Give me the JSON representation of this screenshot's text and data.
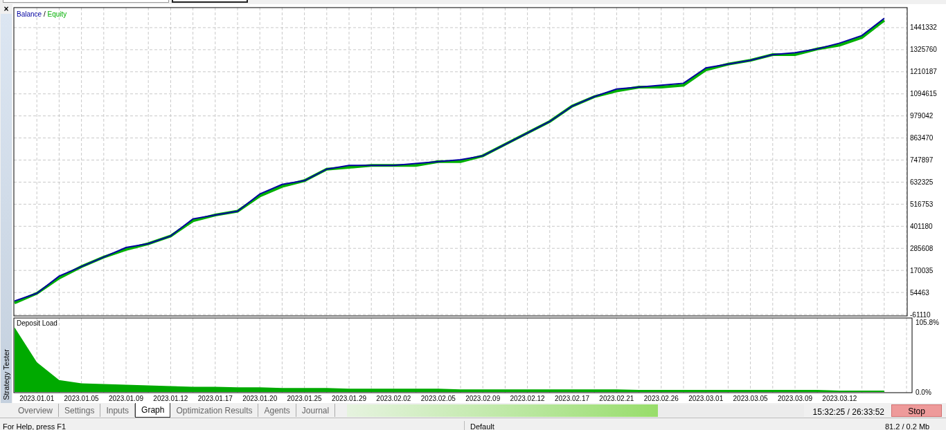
{
  "side_panel": {
    "close": "×",
    "title": "Strategy Tester"
  },
  "main_chart": {
    "separator": "/",
    "chart_data": {
      "type": "line",
      "grid": true,
      "categories": [
        null,
        null,
        null,
        null,
        null,
        null,
        null,
        null,
        null,
        null,
        null,
        null,
        null,
        null,
        null,
        null,
        null,
        null,
        null,
        null,
        null,
        null,
        null,
        null,
        null,
        null,
        null,
        null,
        null,
        null,
        null,
        null,
        null,
        null,
        null,
        null,
        null,
        null,
        null,
        null
      ],
      "ylim": [
        -68350,
        1546170
      ],
      "yticks": [
        -61110,
        54463,
        170035,
        285608,
        401180,
        516753,
        632325,
        747897,
        863470,
        979042,
        1094615,
        1210187,
        1325760,
        1441332
      ],
      "series": [
        {
          "name": "Equity",
          "color": "#00b000",
          "values": [
            0,
            50000,
            130000,
            190000,
            240000,
            280000,
            310000,
            350000,
            430000,
            460000,
            480000,
            560000,
            610000,
            640000,
            700000,
            710000,
            720000,
            720000,
            720000,
            740000,
            740000,
            770000,
            830000,
            890000,
            950000,
            1030000,
            1080000,
            1110000,
            1130000,
            1130000,
            1140000,
            1220000,
            1250000,
            1270000,
            1300000,
            1300000,
            1330000,
            1350000,
            1390000,
            1480000
          ]
        },
        {
          "name": "Balance",
          "color": "#0000a0",
          "values": [
            10000,
            50000,
            140000,
            190000,
            240000,
            290000,
            310000,
            350000,
            440000,
            460000,
            480000,
            570000,
            620000,
            640000,
            700000,
            720000,
            720000,
            720000,
            730000,
            740000,
            750000,
            770000,
            830000,
            890000,
            950000,
            1030000,
            1080000,
            1120000,
            1130000,
            1140000,
            1150000,
            1230000,
            1250000,
            1270000,
            1300000,
            1310000,
            1330000,
            1360000,
            1400000,
            1490000
          ]
        }
      ]
    }
  },
  "deposit_chart": {
    "chart_data": {
      "type": "area",
      "grid": true,
      "categories": [
        null,
        "2023.01.01",
        null,
        "2023.01.05",
        null,
        "2023.01.09",
        null,
        "2023.01.12",
        null,
        "2023.01.17",
        null,
        "2023.01.20",
        null,
        "2023.01.25",
        null,
        "2023.01.29",
        null,
        "2023.02.02",
        null,
        "2023.02.05",
        null,
        "2023.02.09",
        null,
        "2023.02.12",
        null,
        "2023.02.17",
        null,
        "2023.02.21",
        null,
        "2023.02.26",
        null,
        "2023.03.01",
        null,
        "2023.03.05",
        null,
        "2023.03.09",
        null,
        "2023.03.12",
        null,
        null
      ],
      "ylim": [
        0,
        112.1
      ],
      "yticks": [
        {
          "value": 0,
          "label": "0.0%"
        },
        {
          "value": 105.8,
          "label": "105.8%"
        }
      ],
      "series": [
        {
          "name": "Deposit Load",
          "color": "#00aa00",
          "values": [
            98,
            45,
            18,
            13,
            12,
            11,
            10,
            9,
            8,
            8,
            7,
            7,
            6,
            6,
            6,
            5,
            5,
            5,
            5,
            5,
            4,
            4,
            4,
            4,
            4,
            4,
            4,
            4,
            3,
            3,
            3,
            3,
            3,
            3,
            3,
            3,
            3,
            2,
            2,
            2
          ]
        }
      ]
    }
  },
  "tabs": [
    {
      "label": "Overview",
      "selected": false
    },
    {
      "label": "Settings",
      "selected": false
    },
    {
      "label": "Inputs",
      "selected": false
    },
    {
      "label": "Graph",
      "selected": true
    },
    {
      "label": "Optimization Results",
      "selected": false
    },
    {
      "label": "Agents",
      "selected": false
    },
    {
      "label": "Journal",
      "selected": false
    }
  ],
  "progress": {
    "level": 0.68
  },
  "timer": "15:32:25 / 26:33:52",
  "stop_button": "Stop",
  "status_bar": [
    "For Help, press F1",
    "Default",
    "81.2 / 0.2 Mb"
  ]
}
